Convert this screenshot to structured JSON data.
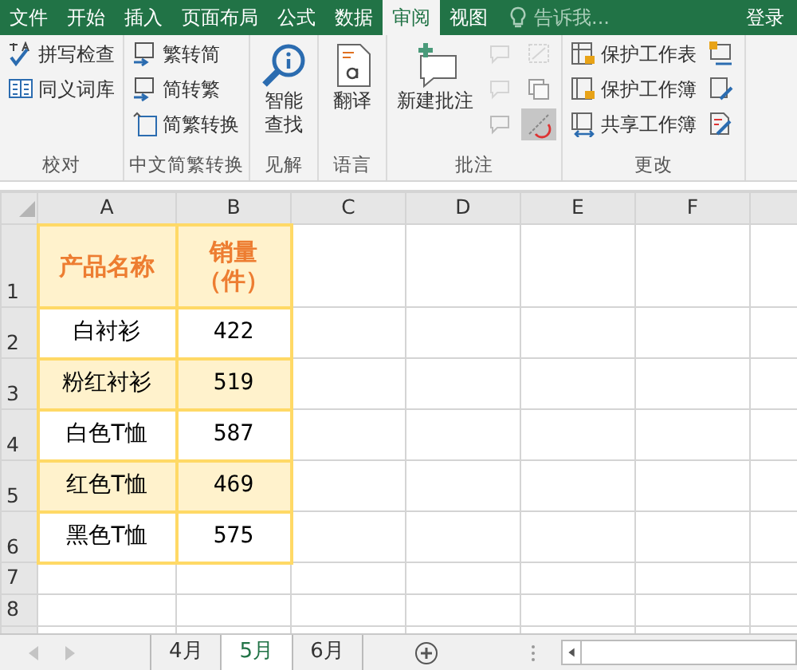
{
  "ribbon_tabs": [
    {
      "label": "文件",
      "selected": false
    },
    {
      "label": "开始",
      "selected": false
    },
    {
      "label": "插入",
      "selected": false
    },
    {
      "label": "页面布局",
      "selected": false
    },
    {
      "label": "公式",
      "selected": false
    },
    {
      "label": "数据",
      "selected": false
    },
    {
      "label": "审阅",
      "selected": true
    },
    {
      "label": "视图",
      "selected": false
    }
  ],
  "tell_me": {
    "placeholder": "告诉我..."
  },
  "sign_in": "登录",
  "ribbon_groups": [
    {
      "label": "校对",
      "items": [
        {
          "kind": "small",
          "label": "拼写检查"
        },
        {
          "kind": "small",
          "label": "同义词库"
        }
      ]
    },
    {
      "label": "中文简繁转换",
      "items": [
        {
          "kind": "small",
          "label": "繁转简"
        },
        {
          "kind": "small",
          "label": "简转繁"
        },
        {
          "kind": "small",
          "label": "简繁转换"
        }
      ]
    },
    {
      "label": "见解",
      "items": [
        {
          "kind": "large",
          "label": "智能查找"
        }
      ]
    },
    {
      "label": "语言",
      "items": [
        {
          "kind": "large",
          "label": "翻译"
        }
      ]
    },
    {
      "label": "批注",
      "items": [
        {
          "kind": "large",
          "label": "新建批注"
        },
        {
          "kind": "icons",
          "buttons": [
            {
              "disabled": true,
              "pressed": false
            },
            {
              "disabled": true,
              "pressed": false
            },
            {
              "disabled": true,
              "pressed": false
            },
            {
              "disabled": true,
              "pressed": false
            },
            {
              "disabled": false,
              "pressed": false
            },
            {
              "disabled": false,
              "pressed": true
            }
          ]
        }
      ]
    },
    {
      "label": "更改",
      "items": [
        {
          "kind": "small",
          "label": "保护工作表"
        },
        {
          "kind": "small",
          "label": "保护工作簿"
        },
        {
          "kind": "small",
          "label": "共享工作簿"
        },
        {
          "kind": "icons",
          "buttons": [
            {
              "disabled": false,
              "pressed": false
            },
            {
              "disabled": false,
              "pressed": false
            },
            {
              "disabled": false,
              "pressed": false
            }
          ]
        }
      ]
    }
  ],
  "sheet": {
    "columns": [
      "A",
      "B",
      "C",
      "D",
      "E",
      "F"
    ],
    "header": {
      "cells": [
        "产品名称",
        "销量（件）"
      ],
      "row_number": "1"
    },
    "rows": [
      {
        "row_number": "2",
        "cells": [
          "白衬衫",
          "422"
        ],
        "shaded": false
      },
      {
        "row_number": "3",
        "cells": [
          "粉红衬衫",
          "519"
        ],
        "shaded": true
      },
      {
        "row_number": "4",
        "cells": [
          "白色T恤",
          "587"
        ],
        "shaded": false
      },
      {
        "row_number": "5",
        "cells": [
          "红色T恤",
          "469"
        ],
        "shaded": true
      },
      {
        "row_number": "6",
        "cells": [
          "黑色T恤",
          "575"
        ],
        "shaded": false
      }
    ],
    "empty_rows": [
      "7",
      "8"
    ]
  },
  "sheet_tabs": [
    {
      "label": "4月",
      "selected": false
    },
    {
      "label": "5月",
      "selected": true
    },
    {
      "label": "6月",
      "selected": false
    }
  ]
}
